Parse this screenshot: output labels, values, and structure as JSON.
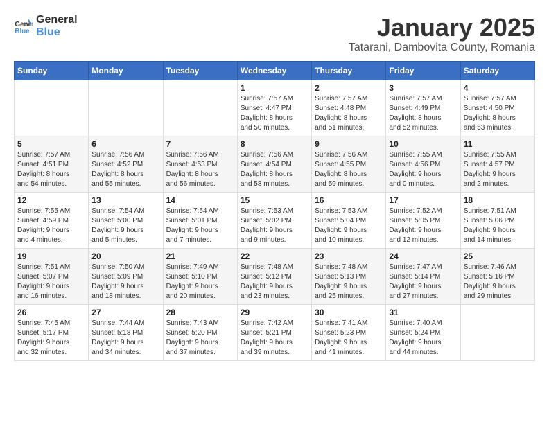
{
  "logo": {
    "text_general": "General",
    "text_blue": "Blue"
  },
  "title": {
    "month": "January 2025",
    "location": "Tatarani, Dambovita County, Romania"
  },
  "days_of_week": [
    "Sunday",
    "Monday",
    "Tuesday",
    "Wednesday",
    "Thursday",
    "Friday",
    "Saturday"
  ],
  "weeks": [
    [
      {
        "day": "",
        "info": ""
      },
      {
        "day": "",
        "info": ""
      },
      {
        "day": "",
        "info": ""
      },
      {
        "day": "1",
        "info": "Sunrise: 7:57 AM\nSunset: 4:47 PM\nDaylight: 8 hours\nand 50 minutes."
      },
      {
        "day": "2",
        "info": "Sunrise: 7:57 AM\nSunset: 4:48 PM\nDaylight: 8 hours\nand 51 minutes."
      },
      {
        "day": "3",
        "info": "Sunrise: 7:57 AM\nSunset: 4:49 PM\nDaylight: 8 hours\nand 52 minutes."
      },
      {
        "day": "4",
        "info": "Sunrise: 7:57 AM\nSunset: 4:50 PM\nDaylight: 8 hours\nand 53 minutes."
      }
    ],
    [
      {
        "day": "5",
        "info": "Sunrise: 7:57 AM\nSunset: 4:51 PM\nDaylight: 8 hours\nand 54 minutes."
      },
      {
        "day": "6",
        "info": "Sunrise: 7:56 AM\nSunset: 4:52 PM\nDaylight: 8 hours\nand 55 minutes."
      },
      {
        "day": "7",
        "info": "Sunrise: 7:56 AM\nSunset: 4:53 PM\nDaylight: 8 hours\nand 56 minutes."
      },
      {
        "day": "8",
        "info": "Sunrise: 7:56 AM\nSunset: 4:54 PM\nDaylight: 8 hours\nand 58 minutes."
      },
      {
        "day": "9",
        "info": "Sunrise: 7:56 AM\nSunset: 4:55 PM\nDaylight: 8 hours\nand 59 minutes."
      },
      {
        "day": "10",
        "info": "Sunrise: 7:55 AM\nSunset: 4:56 PM\nDaylight: 9 hours\nand 0 minutes."
      },
      {
        "day": "11",
        "info": "Sunrise: 7:55 AM\nSunset: 4:57 PM\nDaylight: 9 hours\nand 2 minutes."
      }
    ],
    [
      {
        "day": "12",
        "info": "Sunrise: 7:55 AM\nSunset: 4:59 PM\nDaylight: 9 hours\nand 4 minutes."
      },
      {
        "day": "13",
        "info": "Sunrise: 7:54 AM\nSunset: 5:00 PM\nDaylight: 9 hours\nand 5 minutes."
      },
      {
        "day": "14",
        "info": "Sunrise: 7:54 AM\nSunset: 5:01 PM\nDaylight: 9 hours\nand 7 minutes."
      },
      {
        "day": "15",
        "info": "Sunrise: 7:53 AM\nSunset: 5:02 PM\nDaylight: 9 hours\nand 9 minutes."
      },
      {
        "day": "16",
        "info": "Sunrise: 7:53 AM\nSunset: 5:04 PM\nDaylight: 9 hours\nand 10 minutes."
      },
      {
        "day": "17",
        "info": "Sunrise: 7:52 AM\nSunset: 5:05 PM\nDaylight: 9 hours\nand 12 minutes."
      },
      {
        "day": "18",
        "info": "Sunrise: 7:51 AM\nSunset: 5:06 PM\nDaylight: 9 hours\nand 14 minutes."
      }
    ],
    [
      {
        "day": "19",
        "info": "Sunrise: 7:51 AM\nSunset: 5:07 PM\nDaylight: 9 hours\nand 16 minutes."
      },
      {
        "day": "20",
        "info": "Sunrise: 7:50 AM\nSunset: 5:09 PM\nDaylight: 9 hours\nand 18 minutes."
      },
      {
        "day": "21",
        "info": "Sunrise: 7:49 AM\nSunset: 5:10 PM\nDaylight: 9 hours\nand 20 minutes."
      },
      {
        "day": "22",
        "info": "Sunrise: 7:48 AM\nSunset: 5:12 PM\nDaylight: 9 hours\nand 23 minutes."
      },
      {
        "day": "23",
        "info": "Sunrise: 7:48 AM\nSunset: 5:13 PM\nDaylight: 9 hours\nand 25 minutes."
      },
      {
        "day": "24",
        "info": "Sunrise: 7:47 AM\nSunset: 5:14 PM\nDaylight: 9 hours\nand 27 minutes."
      },
      {
        "day": "25",
        "info": "Sunrise: 7:46 AM\nSunset: 5:16 PM\nDaylight: 9 hours\nand 29 minutes."
      }
    ],
    [
      {
        "day": "26",
        "info": "Sunrise: 7:45 AM\nSunset: 5:17 PM\nDaylight: 9 hours\nand 32 minutes."
      },
      {
        "day": "27",
        "info": "Sunrise: 7:44 AM\nSunset: 5:18 PM\nDaylight: 9 hours\nand 34 minutes."
      },
      {
        "day": "28",
        "info": "Sunrise: 7:43 AM\nSunset: 5:20 PM\nDaylight: 9 hours\nand 37 minutes."
      },
      {
        "day": "29",
        "info": "Sunrise: 7:42 AM\nSunset: 5:21 PM\nDaylight: 9 hours\nand 39 minutes."
      },
      {
        "day": "30",
        "info": "Sunrise: 7:41 AM\nSunset: 5:23 PM\nDaylight: 9 hours\nand 41 minutes."
      },
      {
        "day": "31",
        "info": "Sunrise: 7:40 AM\nSunset: 5:24 PM\nDaylight: 9 hours\nand 44 minutes."
      },
      {
        "day": "",
        "info": ""
      }
    ]
  ]
}
